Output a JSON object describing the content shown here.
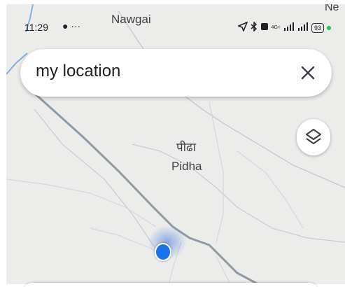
{
  "status_bar": {
    "time": "11:29",
    "left_icons": "● ···",
    "network": "4G+",
    "battery": "93",
    "dot_color": "#1fc157"
  },
  "map": {
    "places": [
      {
        "name": "Nawgai"
      },
      {
        "name": "Ne"
      },
      {
        "name": "पीढा"
      },
      {
        "name": "Pidha"
      }
    ]
  },
  "search": {
    "query": "my location"
  },
  "icons": {
    "clear": "close-icon",
    "layers": "layers-icon",
    "location": "location-arrow-icon",
    "bluetooth": "bluetooth-icon"
  },
  "colors": {
    "location_dot": "#1a73e8",
    "map_background": "#ecedea",
    "road": "#9aa0a6"
  }
}
